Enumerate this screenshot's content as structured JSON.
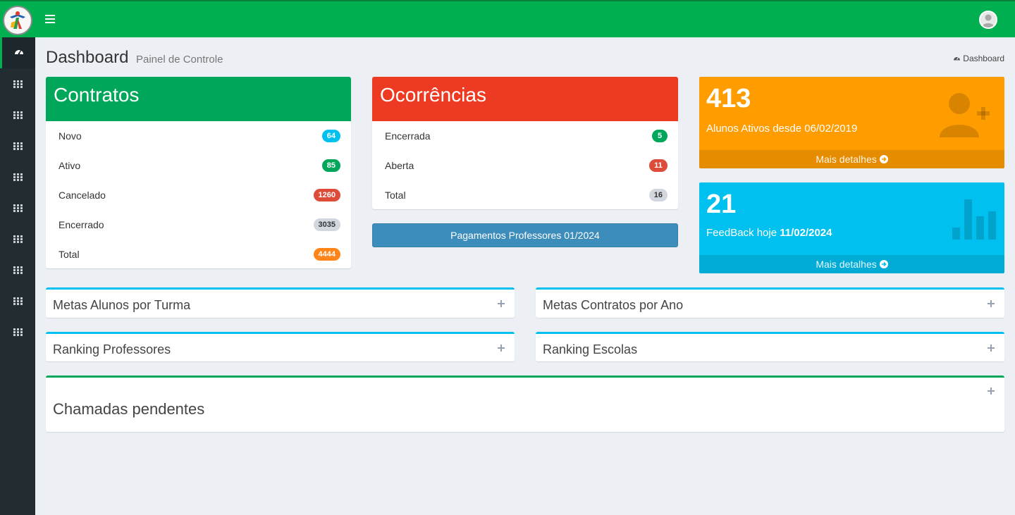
{
  "header": {
    "title": "Dashboard",
    "subtitle": "Painel de Controle",
    "breadcrumb": "Dashboard"
  },
  "contratos": {
    "title": "Contratos",
    "color": "#00a65a",
    "rows": [
      {
        "label": "Novo",
        "value": "64",
        "color": "#00c0ef"
      },
      {
        "label": "Ativo",
        "value": "85",
        "color": "#00a65a"
      },
      {
        "label": "Cancelado",
        "value": "1260",
        "color": "#dd4b39"
      },
      {
        "label": "Encerrado",
        "value": "3035",
        "color": "#d2d6de"
      },
      {
        "label": "Total",
        "value": "4444",
        "color": "#ff851b"
      }
    ]
  },
  "ocorrencias": {
    "title": "Ocorrências",
    "color": "#ec3b22",
    "rows": [
      {
        "label": "Encerrada",
        "value": "5",
        "color": "#00a65a"
      },
      {
        "label": "Aberta",
        "value": "11",
        "color": "#dd4b39"
      },
      {
        "label": "Total",
        "value": "16",
        "color": "#d2d6de"
      }
    ]
  },
  "payments_button": "Pagamentos Professores 01/2024",
  "alunos": {
    "number": "413",
    "description": "Alunos Ativos desde 06/02/2019",
    "link": "Mais detalhes",
    "color": "#ff9c00",
    "icon": "user-plus-icon"
  },
  "feedback": {
    "number": "21",
    "description_prefix": "FeedBack hoje ",
    "description_date": "11/02/2024",
    "link": "Mais detalhes",
    "color": "#00c0ef",
    "icon": "bar-chart-icon"
  },
  "panels": {
    "metas_alunos": "Metas Alunos por Turma",
    "metas_contratos": "Metas Contratos por Ano",
    "ranking_professores": "Ranking Professores",
    "ranking_escolas": "Ranking Escolas",
    "chamadas": "Chamadas pendentes"
  },
  "sidebar": {
    "items": [
      "dashboard-icon",
      "grid-icon",
      "grid-icon",
      "grid-icon",
      "grid-icon",
      "grid-icon",
      "grid-icon",
      "grid-icon",
      "grid-icon",
      "grid-icon"
    ]
  },
  "colors": {
    "topbar": "#00b050",
    "sidebar": "#222d32",
    "background": "#ecf0f5",
    "panel_border_blue": "#00c0ef",
    "panel_border_green": "#00a65a"
  }
}
